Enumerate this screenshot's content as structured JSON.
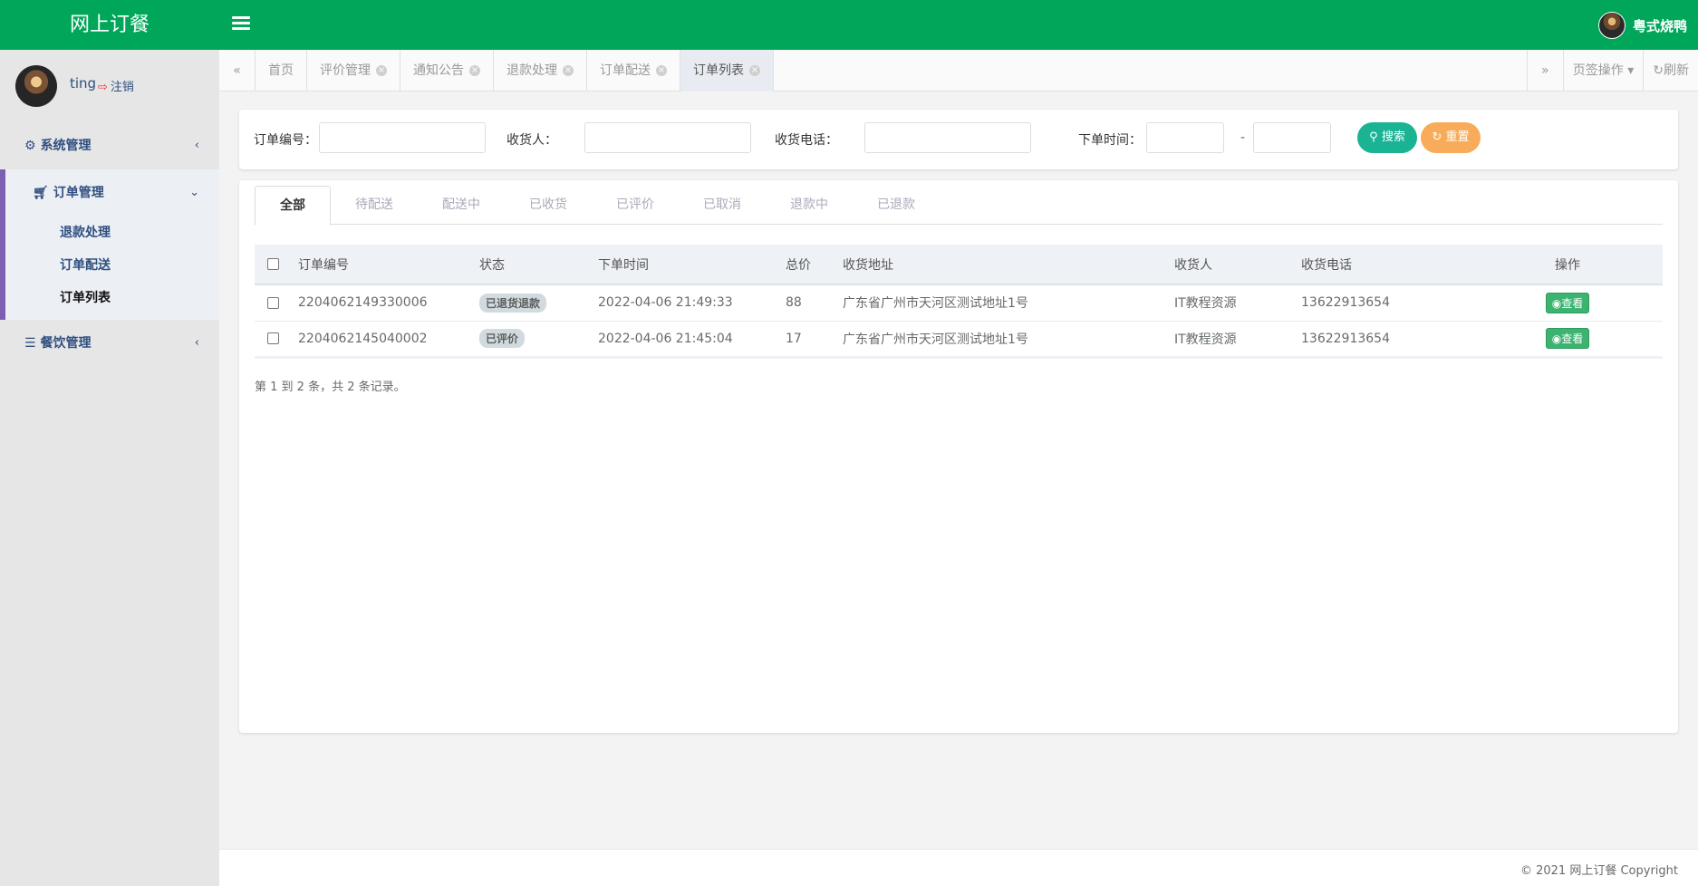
{
  "app": {
    "title": "网上订餐"
  },
  "topbar": {
    "user_name": "粤式烧鸭"
  },
  "sidebar": {
    "user": "ting",
    "logout": "注销",
    "menu": [
      {
        "label": "系统管理",
        "icon": "gear-icon"
      },
      {
        "label": "订单管理",
        "icon": "cart-icon",
        "children": [
          "退款处理",
          "订单配送",
          "订单列表"
        ]
      },
      {
        "label": "餐饮管理",
        "icon": "list-icon"
      }
    ]
  },
  "page_tabs": {
    "items": [
      "首页",
      "评价管理",
      "通知公告",
      "退款处理",
      "订单配送",
      "订单列表"
    ],
    "active": "订单列表",
    "page_ops": "页签操作",
    "refresh": "刷新"
  },
  "search": {
    "order_no_label": "订单编号：",
    "receiver_label": "收货人：",
    "phone_label": "收货电话：",
    "time_label": "下单时间：",
    "dash": "-",
    "search_btn": "搜索",
    "reset_btn": "重置"
  },
  "status_tabs": [
    "全部",
    "待配送",
    "配送中",
    "已收货",
    "已评价",
    "已取消",
    "退款中",
    "已退款"
  ],
  "table": {
    "headers": [
      "订单编号",
      "状态",
      "下单时间",
      "总价",
      "收货地址",
      "收货人",
      "收货电话",
      "操作"
    ],
    "rows": [
      {
        "order_no": "2204062149330006",
        "status": "已退货退款",
        "time": "2022-04-06 21:49:33",
        "total": "88",
        "address": "广东省广州市天河区测试地址1号",
        "receiver": "IT教程资源",
        "phone": "13622913654",
        "action": "查看"
      },
      {
        "order_no": "2204062145040002",
        "status": "已评价",
        "time": "2022-04-06 21:45:04",
        "total": "17",
        "address": "广东省广州市天河区测试地址1号",
        "receiver": "IT教程资源",
        "phone": "13622913654",
        "action": "查看"
      }
    ]
  },
  "pager": "第 1 到 2 条，共 2 条记录。",
  "footer": "© 2021 网上订餐 Copyright",
  "colors": {
    "topbar": "#00a65a",
    "search_btn": "#1ab394",
    "reset_btn": "#f8ac59",
    "view_btn": "#3cb371"
  }
}
